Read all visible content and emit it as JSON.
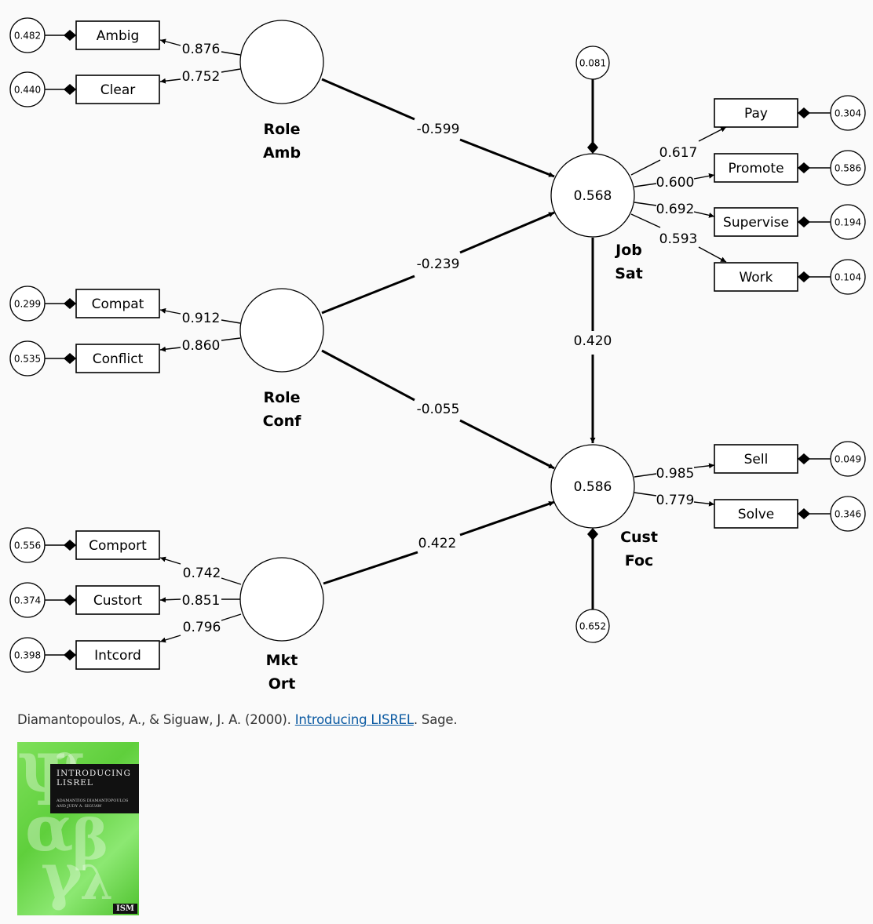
{
  "diagram": {
    "latents": [
      {
        "id": "roleamb",
        "label_line1": "Role",
        "label_line2": "Amb",
        "value": ""
      },
      {
        "id": "roleconf",
        "label_line1": "Role",
        "label_line2": "Conf",
        "value": ""
      },
      {
        "id": "mktort",
        "label_line1": "Mkt",
        "label_line2": "Ort",
        "value": ""
      },
      {
        "id": "jobsat",
        "label_line1": "Job",
        "label_line2": "Sat",
        "value": "0.568"
      },
      {
        "id": "custfoc",
        "label_line1": "Cust",
        "label_line2": "Foc",
        "value": "0.586"
      }
    ],
    "indicators": [
      {
        "id": "ambig",
        "label": "Ambig",
        "latent": "roleamb",
        "loading": "0.876",
        "error": "0.482"
      },
      {
        "id": "clear",
        "label": "Clear",
        "latent": "roleamb",
        "loading": "0.752",
        "error": "0.440"
      },
      {
        "id": "compat",
        "label": "Compat",
        "latent": "roleconf",
        "loading": "0.912",
        "error": "0.299"
      },
      {
        "id": "conflict",
        "label": "Conflict",
        "latent": "roleconf",
        "loading": "0.860",
        "error": "0.535"
      },
      {
        "id": "comport",
        "label": "Comport",
        "latent": "mktort",
        "loading": "0.742",
        "error": "0.556"
      },
      {
        "id": "custort",
        "label": "Custort",
        "latent": "mktort",
        "loading": "0.851",
        "error": "0.374"
      },
      {
        "id": "intcord",
        "label": "Intcord",
        "latent": "mktort",
        "loading": "0.796",
        "error": "0.398"
      },
      {
        "id": "pay",
        "label": "Pay",
        "latent": "jobsat",
        "loading": "0.617",
        "error": "0.304"
      },
      {
        "id": "promote",
        "label": "Promote",
        "latent": "jobsat",
        "loading": "0.600",
        "error": "0.586"
      },
      {
        "id": "supervise",
        "label": "Supervise",
        "latent": "jobsat",
        "loading": "0.692",
        "error": "0.194"
      },
      {
        "id": "work",
        "label": "Work",
        "latent": "jobsat",
        "loading": "0.593",
        "error": "0.104"
      },
      {
        "id": "sell",
        "label": "Sell",
        "latent": "custfoc",
        "loading": "0.985",
        "error": "0.049"
      },
      {
        "id": "solve",
        "label": "Solve",
        "latent": "custfoc",
        "loading": "0.779",
        "error": "0.346"
      }
    ],
    "paths": [
      {
        "from": "roleamb",
        "to": "jobsat",
        "coef": "-0.599"
      },
      {
        "from": "roleconf",
        "to": "jobsat",
        "coef": "-0.239"
      },
      {
        "from": "roleconf",
        "to": "custfoc",
        "coef": "-0.055"
      },
      {
        "from": "mktort",
        "to": "custfoc",
        "coef": "0.422"
      },
      {
        "from": "jobsat",
        "to": "custfoc",
        "coef": "0.420"
      }
    ],
    "disturbances": [
      {
        "latent": "jobsat",
        "value": "0.081"
      },
      {
        "latent": "custfoc",
        "value": "0.652"
      }
    ]
  },
  "citation": {
    "authors": "Diamantopoulos, A., & Siguaw, J. A. (2000). ",
    "link_text": "Introducing LISREL",
    "publisher": ". Sage."
  },
  "cover": {
    "title": "INTRODUCING\nLISREL",
    "authors": "ADAMANTIOS DIAMANTOPOULOS\nAND JUDY A. SIGUAW",
    "publisher": "ISM"
  }
}
